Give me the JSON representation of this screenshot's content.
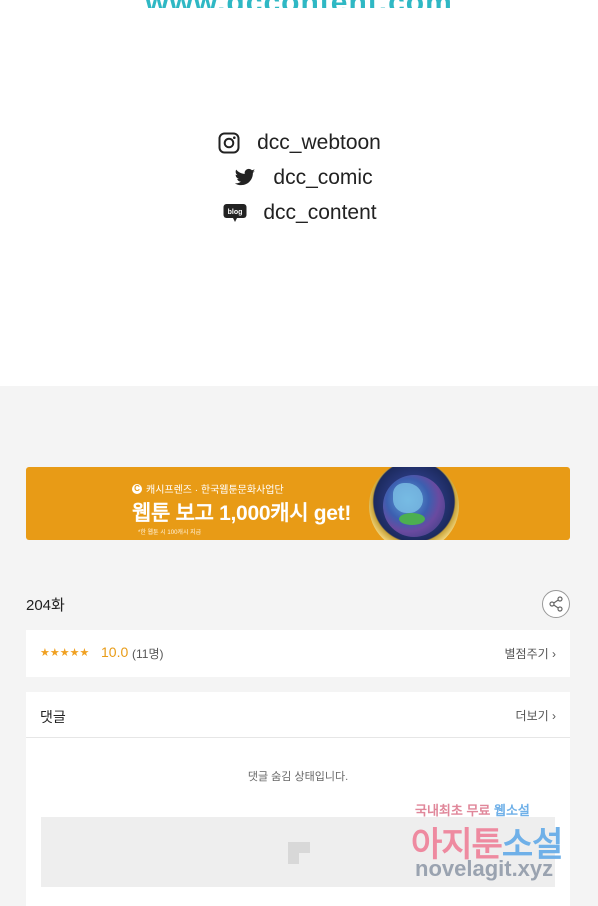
{
  "header": {
    "cut_url_text": "www.dccontent.com"
  },
  "social": {
    "items": [
      {
        "icon": "instagram-icon",
        "handle": "dcc_webtoon"
      },
      {
        "icon": "twitter-icon",
        "handle": "dcc_comic"
      },
      {
        "icon": "blog-icon",
        "handle": "dcc_content"
      }
    ],
    "blog_icon_text": "blog"
  },
  "banner": {
    "small_text": "캐시프렌즈 · 한국웹툰문화사업단",
    "small_icon_text": "C",
    "main_text": "웹툰 보고 1,000캐시 get!",
    "tiny_text": "*한 웹툰 시 100캐시 지급",
    "accent_color": "#e89b16"
  },
  "episode": {
    "title": "204화"
  },
  "rating": {
    "stars": "★★★★★",
    "score": "10.0",
    "count": "(11명)",
    "rate_link": "별점주기 ›"
  },
  "comments": {
    "title": "댓글",
    "more_link": "더보기 ›",
    "hidden_message": "댓글 숨김 상태입니다."
  },
  "watermark": {
    "line1_a": "국내최초 무료",
    "line1_b": "웹소설",
    "line2_a": "아지툰",
    "line2_b": "소설",
    "line3": "novelagit.xyz"
  }
}
